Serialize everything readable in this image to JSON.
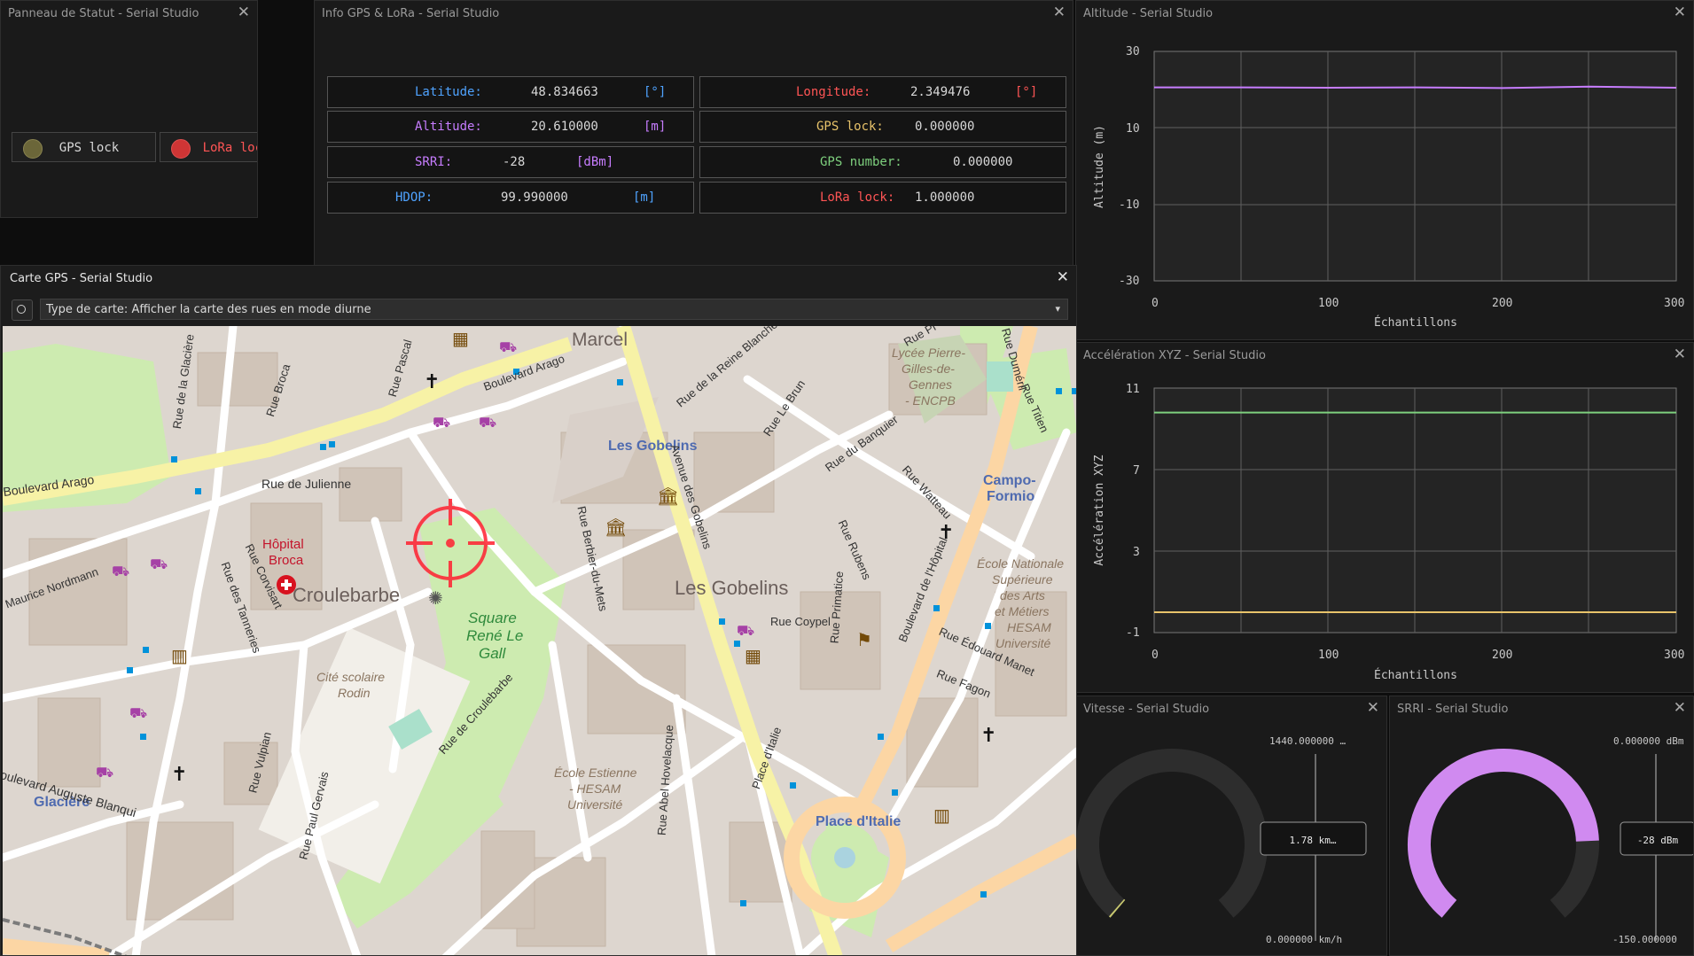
{
  "status_panel": {
    "title": "Panneau de Statut - Serial Studio",
    "gps_lock_label": "GPS lock",
    "lora_lock_label": "LoRa lock"
  },
  "gps_info": {
    "title": "Info GPS & LoRa - Serial Studio",
    "left_column": [
      {
        "label": "Latitude:",
        "value": "48.834663",
        "unit": "[°]",
        "color": "#4fa3ff"
      },
      {
        "label": "Altitude:",
        "value": "20.610000",
        "unit": "[m]",
        "color": "#c77dff"
      },
      {
        "label": "SRRI:",
        "value": "-28",
        "unit": "[dBm]",
        "color": "#c77dff"
      },
      {
        "label": "HDOP:",
        "value": "99.990000",
        "unit": "[m]",
        "color": "#4fa3ff"
      }
    ],
    "right_column": [
      {
        "label": "Longitude:",
        "value": "2.349476",
        "unit": "[°]",
        "color": "#ff5555"
      },
      {
        "label": "GPS lock:",
        "value": "0.000000",
        "unit": "",
        "color": "#e8c36a"
      },
      {
        "label": "GPS number:",
        "value": "0.000000",
        "unit": "",
        "color": "#7ed07e"
      },
      {
        "label": "LoRa lock:",
        "value": "1.000000",
        "unit": "",
        "color": "#ff5555"
      }
    ]
  },
  "map_window": {
    "title": "Carte GPS - Serial Studio",
    "map_type_select": "Type de carte: Afficher la carte des rues en mode diurne",
    "labels": {
      "marcel": "Marcel",
      "gobelins1": "Les Gobelins",
      "gobelins2": "Les Gobelins",
      "croulebarbe": "Croulebarbe",
      "hopital": "Hôpital",
      "broca": "Broca",
      "square1": "Square",
      "square2": "René Le",
      "square3": "Gall",
      "campo1": "Campo-",
      "campo2": "Formio",
      "boulevard_arago_left": "Boulevard Arago",
      "boulevard_arago": "Boulevard Arago",
      "rue_julienne": "Rue de Julienne",
      "rue_coypel": "Rue Coypel",
      "place_italie": "Place d'Italie",
      "glaciere": "Glacière",
      "avenue_gobelins": "Avenue des Gobelins",
      "bd_hopital": "Boulevard de l'Hôpital",
      "lycee1": "Lycée Pierre-",
      "lycee2": "Gilles-de-",
      "lycee3": "Gennes",
      "lycee4": "- ENCPB",
      "ecole_nat1": "École Nationale",
      "ecole_nat2": "Supérieure",
      "ecole_nat3": "des Arts",
      "ecole_nat4": "et Métiers",
      "ecole_nat5": "HESAM",
      "ecole_nat6": "Université",
      "cite1": "Cité scolaire",
      "cite2": "Rodin",
      "estienne1": "École Estienne",
      "estienne2": "- HESAM",
      "estienne3": "Université",
      "bd_blanqui": "oulevard Auguste Blanqui",
      "rue_edouard_manet": "Rue Édouard Manet",
      "rue_fagon": "Rue Fagon",
      "rue_du_banquier": "Rue du Banquier",
      "rue_watteau": "Rue Watteau",
      "rue_rubens": "Rue Rubens",
      "rue_le_brun": "Rue Le Brun",
      "rue_reine_blanche": "Rue de la Reine Blanche",
      "rue_pascal": "Rue Pascal",
      "rue_broca": "Rue Broca",
      "rue_glaciere": "Rue de la Glacière",
      "rue_corvisart": "Rue Corvisart",
      "rue_tanneries": "Rue des Tanneries",
      "maurice_nordmann": "Maurice Nordmann",
      "rue_croulebarbe": "Rue de Croulebarbe",
      "rue_berbier": "Rue Berbier-du-Mets",
      "rue_primatice": "Rue Primatice",
      "rue_vulpian": "Rue Vulpian",
      "rue_gervais": "Rue Paul Gervais",
      "rue_hovelacque": "Rue Abel Hovelacque",
      "place_italie_av": "Place d'Italie",
      "rue_dumeril": "Rue Duméril",
      "rue_titien": "Rue Titien",
      "rue_pi": "Rue Pi"
    }
  },
  "altitude_plot": {
    "title": "Altitude - Serial Studio",
    "ylabel": "Altitude (m)",
    "xlabel": "Échantillons",
    "yticks": [
      "30",
      "10",
      "-10",
      "-30"
    ],
    "xticks": [
      "0",
      "100",
      "200",
      "300"
    ],
    "color": "#c77dff"
  },
  "accel_plot": {
    "title": "Accélération XYZ - Serial Studio",
    "ylabel": "Accélération XYZ",
    "xlabel": "Échantillons",
    "yticks": [
      "11",
      "7",
      "3",
      "-1"
    ],
    "xticks": [
      "0",
      "100",
      "200",
      "300"
    ],
    "series_colors": [
      "#7ed07e",
      "#e8c36a"
    ]
  },
  "chart_data": [
    {
      "type": "line",
      "title": "Altitude - Serial Studio",
      "xlabel": "Échantillons",
      "ylabel": "Altitude (m)",
      "xlim": [
        0,
        300
      ],
      "ylim": [
        -30,
        30
      ],
      "grid": true,
      "series": [
        {
          "x": [
            0,
            50,
            100,
            150,
            200,
            250,
            300
          ],
          "y": [
            20.6,
            20.6,
            20.5,
            20.6,
            20.4,
            20.8,
            20.5
          ]
        }
      ]
    },
    {
      "type": "line",
      "title": "Accélération XYZ - Serial Studio",
      "xlabel": "Échantillons",
      "ylabel": "Accélération XYZ",
      "xlim": [
        0,
        300
      ],
      "ylim": [
        -1,
        11
      ],
      "grid": true,
      "series": [
        {
          "x": [
            0,
            50,
            100,
            150,
            200,
            250,
            300
          ],
          "y": [
            9.8,
            9.8,
            9.8,
            9.8,
            9.8,
            9.8,
            9.8
          ]
        },
        {
          "x": [
            0,
            50,
            100,
            150,
            200,
            250,
            300
          ],
          "y": [
            0.0,
            0.0,
            0.0,
            0.0,
            0.0,
            0.0,
            0.0
          ]
        }
      ]
    }
  ],
  "vitesse": {
    "title": "Vitesse - Serial Studio",
    "max_label": "1440.000000 …",
    "value_label": "1.78 km…",
    "min_label": "0.000000 km/h",
    "value": 1.78,
    "min": 0,
    "max": 1440,
    "color": "#c8c870"
  },
  "srri": {
    "title": "SRRI - Serial Studio",
    "max_label": "0.000000 dBm",
    "value_label": "-28 dBm",
    "min_label": "-150.000000",
    "value": -28,
    "min": -150,
    "max": 0,
    "color": "#d08af0"
  }
}
